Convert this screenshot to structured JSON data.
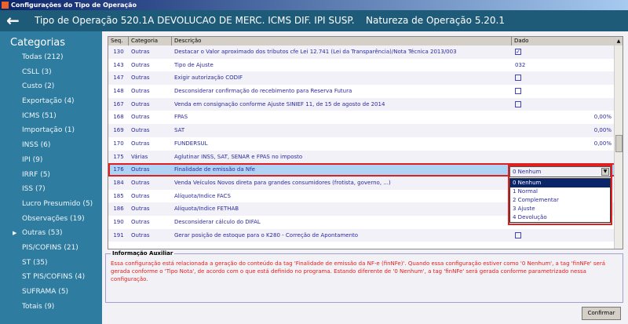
{
  "window_title": "Configurações do Tipo de Operação",
  "header": {
    "tipo": "Tipo de Operação 520.1A  DEVOLUCAO DE MERC. ICMS DIF. IPI SUSP.",
    "natureza": "Natureza de Operação 5.20.1"
  },
  "sidebar": {
    "title": "Categorias",
    "items": [
      {
        "label": "Todas (212)"
      },
      {
        "label": "CSLL (3)"
      },
      {
        "label": "Custo (2)"
      },
      {
        "label": "Exportação (4)"
      },
      {
        "label": "ICMS (51)"
      },
      {
        "label": "Importação (1)"
      },
      {
        "label": "INSS (6)"
      },
      {
        "label": "IPI (9)"
      },
      {
        "label": "IRRF (5)"
      },
      {
        "label": "ISS (7)"
      },
      {
        "label": "Lucro Presumido (5)"
      },
      {
        "label": "Observações (19)"
      },
      {
        "label": "Outras (53)",
        "selected": true
      },
      {
        "label": "PIS/COFINS (21)"
      },
      {
        "label": "ST (35)"
      },
      {
        "label": "ST PIS/COFINS (4)"
      },
      {
        "label": "SUFRAMA (5)"
      },
      {
        "label": "Totais (9)"
      }
    ]
  },
  "grid": {
    "columns": [
      "Seq.",
      "Categoria",
      "Descrição",
      "Dado"
    ],
    "rows": [
      {
        "seq": "130",
        "cat": "Outras",
        "desc": "Destacar o Valor aproximado dos tributos cfe Lei 12.741 (Lei da Transparência)/Nota Técnica 2013/003",
        "type": "check",
        "checked": true
      },
      {
        "seq": "143",
        "cat": "Outras",
        "desc": "Tipo de Ajuste",
        "type": "text",
        "value": "032"
      },
      {
        "seq": "147",
        "cat": "Outras",
        "desc": "Exigir autorização CODIF",
        "type": "check",
        "checked": false
      },
      {
        "seq": "148",
        "cat": "Outras",
        "desc": "Desconsiderar confirmação do recebimento para Reserva Futura",
        "type": "check",
        "checked": false
      },
      {
        "seq": "167",
        "cat": "Outras",
        "desc": "Venda em consignação conforme Ajuste SINIEF 11, de 15 de agosto de 2014",
        "type": "check",
        "checked": false
      },
      {
        "seq": "168",
        "cat": "Outras",
        "desc": "FPAS",
        "type": "pct",
        "value": "0,00%"
      },
      {
        "seq": "169",
        "cat": "Outras",
        "desc": "SAT",
        "type": "pct",
        "value": "0,00%"
      },
      {
        "seq": "170",
        "cat": "Outras",
        "desc": "FUNDERSUL",
        "type": "pct",
        "value": "0,00%"
      },
      {
        "seq": "175",
        "cat": "Várias",
        "desc": "Aglutinar INSS, SAT, SENAR e FPAS no imposto",
        "type": "none"
      },
      {
        "seq": "176",
        "cat": "Outras",
        "desc": "Finalidade de emissão da Nfe",
        "type": "combo",
        "selected": true
      },
      {
        "seq": "184",
        "cat": "Outras",
        "desc": "Venda Veículos Novos direta para grandes consumidores (frotista, governo, ...)",
        "type": "none"
      },
      {
        "seq": "185",
        "cat": "Outras",
        "desc": "Alíquota/Indice FACS",
        "type": "none"
      },
      {
        "seq": "186",
        "cat": "Outras",
        "desc": "Alíquota/Indice FETHAB",
        "type": "none"
      },
      {
        "seq": "190",
        "cat": "Outras",
        "desc": "Desconsiderar cálculo do DIFAL",
        "type": "none"
      },
      {
        "seq": "191",
        "cat": "Outras",
        "desc": "Gerar posição de estoque para o K280 - Correção de Apontamento",
        "type": "check",
        "checked": false
      }
    ]
  },
  "combo": {
    "value": "0  Nenhum",
    "options": [
      "0  Nenhum",
      "1 Normal",
      "2 Complementar",
      "3 Ajuste",
      "4  Devolução"
    ]
  },
  "info": {
    "legend": "Informação Auxiliar",
    "text": "Essa configuração está relacionada a geração do conteúdo da tag 'Finalidade de emissão da NF-e (finNFe)'. Quando essa configuração estiver como '0 Nenhum', a tag 'finNFe' será gerada conforme o 'Tipo Nota', de acordo com o que está definido no programa. Estando diferente de '0 Nenhum', a tag 'finNFe' será gerada conforme parametrizado nessa configuração."
  },
  "confirm_label": "Confirmar"
}
